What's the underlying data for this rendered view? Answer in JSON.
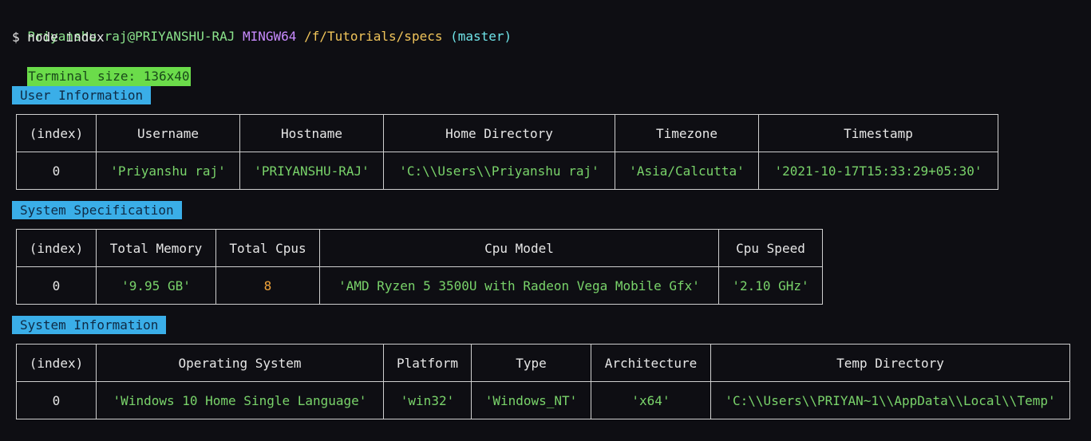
{
  "prompt": {
    "user": "Priyanshu raj@PRIYANSHU-RAJ",
    "system": "MINGW64",
    "path": "/f/Tutorials/specs",
    "branch": "(master)"
  },
  "command": "$ node index",
  "terminal_size": "Terminal size: 136x40",
  "colors": {
    "background": "#0e0e13",
    "string": "#79d36a",
    "number": "#f2a43a",
    "label_bg": "#3aaee8",
    "size_badge_bg": "#6bdc4a"
  },
  "user_info": {
    "label": "User Information",
    "headers": [
      "(index)",
      "Username",
      "Hostname",
      "Home Directory",
      "Timezone",
      "Timestamp"
    ],
    "row": [
      "0",
      "'Priyanshu raj'",
      "'PRIYANSHU-RAJ'",
      "'C:\\\\Users\\\\Priyanshu raj'",
      "'Asia/Calcutta'",
      "'2021-10-17T15:33:29+05:30'"
    ]
  },
  "system_spec": {
    "label": "System Specification",
    "headers": [
      "(index)",
      "Total Memory",
      "Total Cpus",
      "Cpu Model",
      "Cpu Speed"
    ],
    "row": [
      "0",
      "'9.95 GB'",
      "8",
      "'AMD Ryzen 5 3500U with Radeon Vega Mobile Gfx'",
      "'2.10 GHz'"
    ]
  },
  "system_info": {
    "label": "System Information",
    "headers": [
      "(index)",
      "Operating System",
      "Platform",
      "Type",
      "Architecture",
      "Temp Directory"
    ],
    "row": [
      "0",
      "'Windows 10 Home Single Language'",
      "'win32'",
      "'Windows_NT'",
      "'x64'",
      "'C:\\\\Users\\\\PRIYAN~1\\\\AppData\\\\Local\\\\Temp'"
    ]
  }
}
